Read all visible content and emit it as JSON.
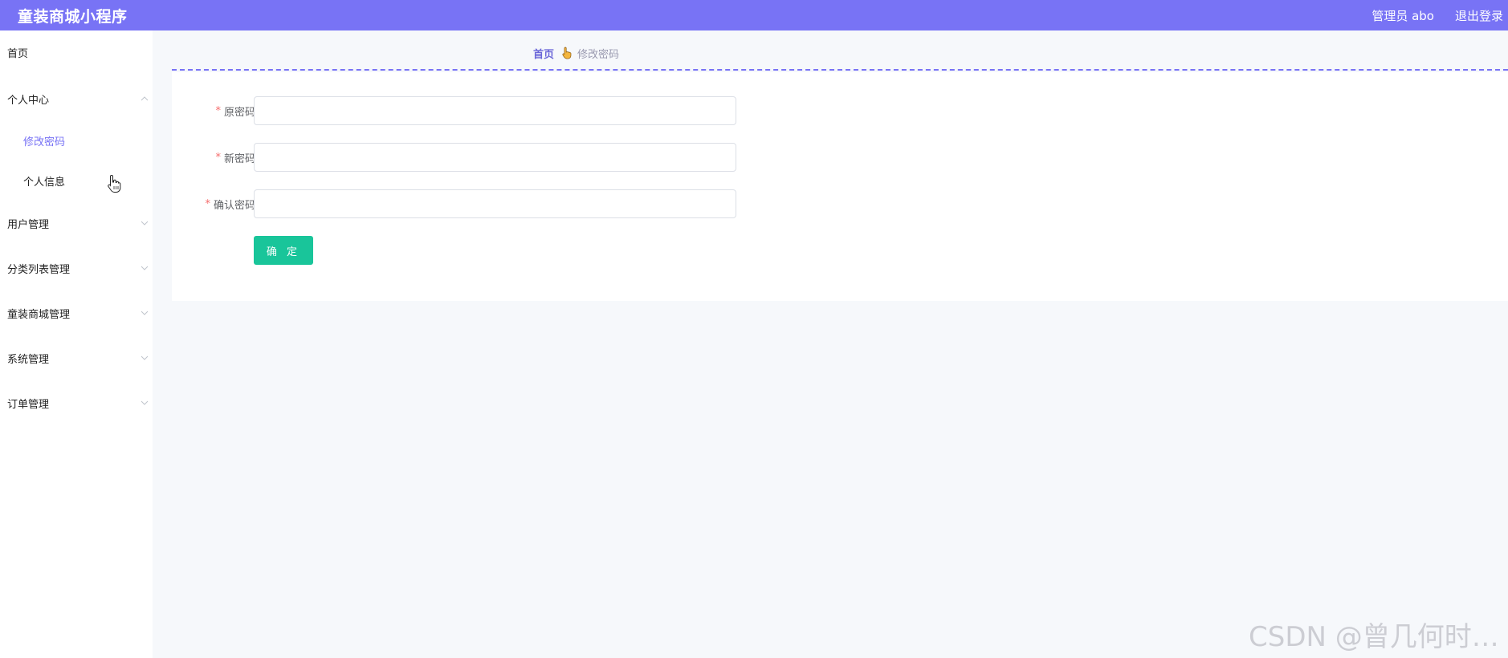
{
  "header": {
    "title": "童装商城小程序",
    "user": "管理员 abo",
    "logout": "退出登录",
    "bg_color": "#7873f5"
  },
  "sidebar": {
    "items": [
      {
        "label": "首页",
        "icon": "none"
      },
      {
        "label": "个人中心",
        "icon": "chevron-up-icon"
      },
      {
        "label": "修改密码",
        "active": true
      },
      {
        "label": "个人信息"
      },
      {
        "label": "用户管理",
        "icon": "chevron-down-icon"
      },
      {
        "label": "分类列表管理",
        "icon": "chevron-down-icon"
      },
      {
        "label": "童装商城管理",
        "icon": "chevron-down-icon"
      },
      {
        "label": "系统管理",
        "icon": "chevron-down-icon"
      },
      {
        "label": "订单管理",
        "icon": "chevron-down-icon"
      }
    ],
    "active_color": "#7873f5"
  },
  "breadcrumb": {
    "home": "首页",
    "separator_icon": "hand-emoji-icon",
    "current": "修改密码"
  },
  "form": {
    "fields": [
      {
        "label": "原密码",
        "required": "*",
        "value": ""
      },
      {
        "label": "新密码",
        "required": "*",
        "value": ""
      },
      {
        "label": "确认密码",
        "required": "*",
        "value": ""
      }
    ],
    "submit_label": "确 定",
    "submit_color": "#19c59a"
  },
  "watermark": "CSDN @曾几何时…"
}
